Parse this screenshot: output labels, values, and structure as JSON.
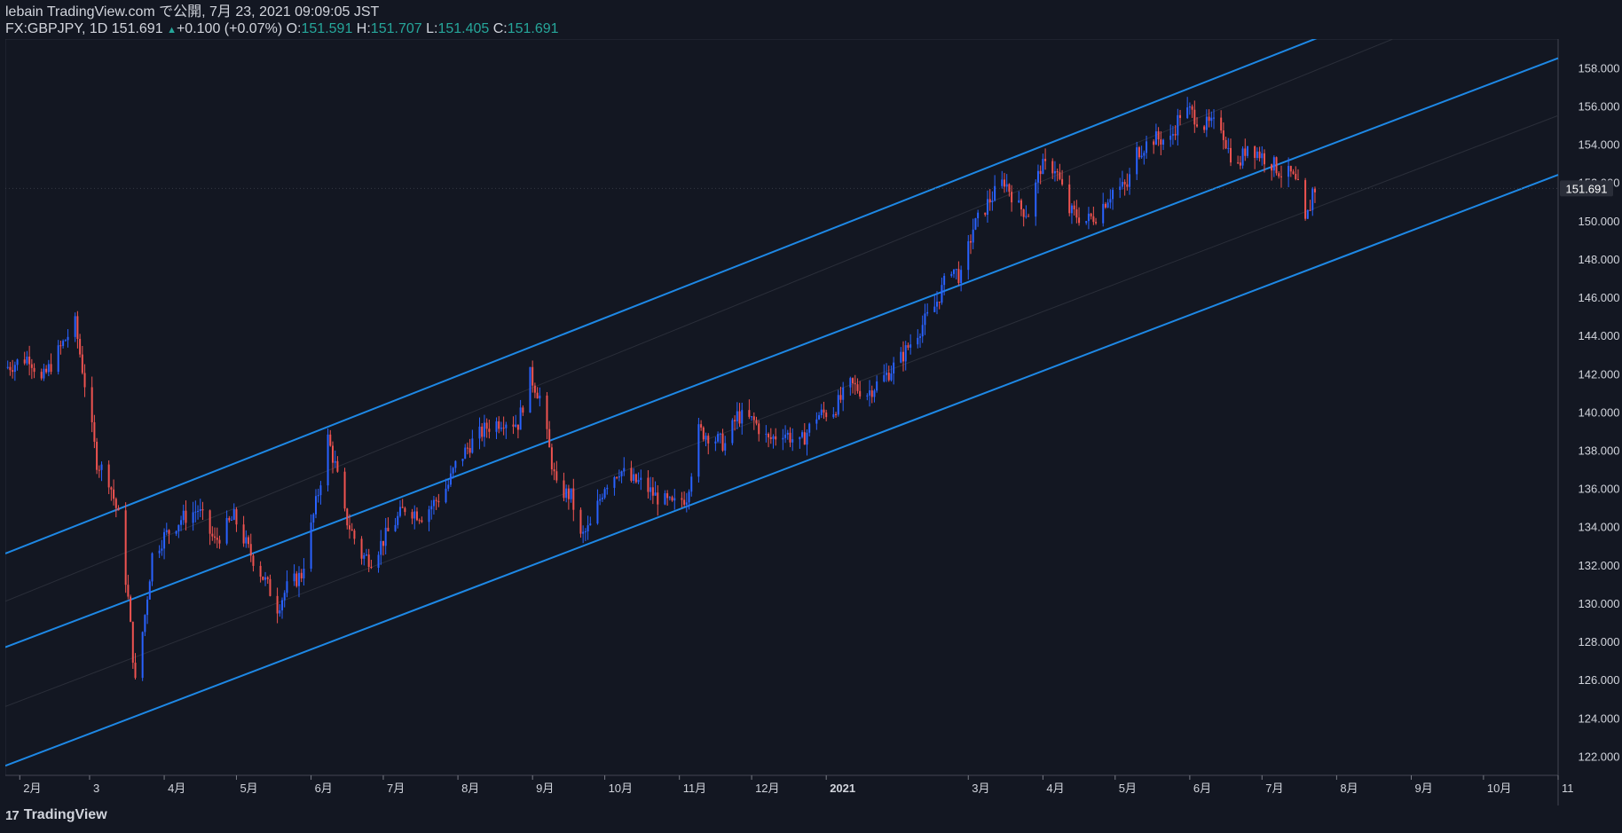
{
  "header": {
    "line1": "lebain TradingView.com で公開, 7月 23, 2021 09:09:05 JST",
    "symbol": "FX:GBPJPY, 1D",
    "last": "151.691",
    "change": "+0.100 (+0.07%)",
    "o_label": "O:",
    "o_value": "151.591",
    "h_label": "H:",
    "h_value": "151.707",
    "l_label": "L:",
    "l_value": "151.405",
    "c_label": "C:",
    "c_value": "151.691"
  },
  "footer": {
    "brand": "TradingView",
    "logo": "17"
  },
  "colors": {
    "background": "#131722",
    "up": "#2962ff",
    "down": "#ef5350",
    "channel": "#1e88e5",
    "text": "#d1d4dc",
    "accent": "#26a69a"
  },
  "chart_data": {
    "type": "candlestick",
    "symbol": "FX:GBPJPY",
    "interval": "1D",
    "ylim": [
      121,
      159.5
    ],
    "x_range": [
      "2020-01-26",
      "2021-11-01"
    ],
    "y_ticks": [
      "122.000",
      "124.000",
      "126.000",
      "128.000",
      "130.000",
      "132.000",
      "134.000",
      "136.000",
      "138.000",
      "140.000",
      "142.000",
      "144.000",
      "146.000",
      "148.000",
      "150.000",
      "152.000",
      "154.000",
      "156.000",
      "158.000"
    ],
    "x_ticks": [
      {
        "label": "2月",
        "date": "2020-02-01"
      },
      {
        "label": "3",
        "date": "2020-03-01"
      },
      {
        "label": "4月",
        "date": "2020-04-01"
      },
      {
        "label": "5月",
        "date": "2020-05-01"
      },
      {
        "label": "6月",
        "date": "2020-06-01"
      },
      {
        "label": "7月",
        "date": "2020-07-01"
      },
      {
        "label": "8月",
        "date": "2020-08-01"
      },
      {
        "label": "9月",
        "date": "2020-09-01"
      },
      {
        "label": "10月",
        "date": "2020-10-01"
      },
      {
        "label": "11月",
        "date": "2020-11-01"
      },
      {
        "label": "12月",
        "date": "2020-12-01"
      },
      {
        "label": "2021",
        "date": "2021-01-01"
      },
      {
        "label": "3月",
        "date": "2021-03-01"
      },
      {
        "label": "4月",
        "date": "2021-04-01"
      },
      {
        "label": "5月",
        "date": "2021-05-01"
      },
      {
        "label": "6月",
        "date": "2021-06-01"
      },
      {
        "label": "7月",
        "date": "2021-07-01"
      },
      {
        "label": "8月",
        "date": "2021-08-01"
      },
      {
        "label": "9月",
        "date": "2021-09-01"
      },
      {
        "label": "10月",
        "date": "2021-10-01"
      },
      {
        "label": "11",
        "date": "2021-11-01"
      }
    ],
    "last_price": "151.691",
    "last_price_value": 151.691,
    "price_path": [
      [
        "2020-01-26",
        142.3
      ],
      [
        "2020-02-05",
        142.9
      ],
      [
        "2020-02-10",
        141.6
      ],
      [
        "2020-02-20",
        143.8
      ],
      [
        "2020-02-24",
        144.6
      ],
      [
        "2020-02-28",
        141.5
      ],
      [
        "2020-03-04",
        137.4
      ],
      [
        "2020-03-09",
        136.5
      ],
      [
        "2020-03-13",
        134.5
      ],
      [
        "2020-03-17",
        130.2
      ],
      [
        "2020-03-20",
        125.8
      ],
      [
        "2020-03-24",
        129.4
      ],
      [
        "2020-03-27",
        132.5
      ],
      [
        "2020-04-01",
        133.5
      ],
      [
        "2020-04-08",
        134.4
      ],
      [
        "2020-04-15",
        134.9
      ],
      [
        "2020-04-22",
        133.2
      ],
      [
        "2020-04-30",
        134.5
      ],
      [
        "2020-05-06",
        132.8
      ],
      [
        "2020-05-14",
        130.9
      ],
      [
        "2020-05-18",
        129.8
      ],
      [
        "2020-05-22",
        130.8
      ],
      [
        "2020-05-28",
        131.5
      ],
      [
        "2020-06-04",
        135.8
      ],
      [
        "2020-06-08",
        138.6
      ],
      [
        "2020-06-11",
        137.2
      ],
      [
        "2020-06-15",
        134.6
      ],
      [
        "2020-06-22",
        132.5
      ],
      [
        "2020-06-26",
        132.3
      ],
      [
        "2020-07-03",
        133.7
      ],
      [
        "2020-07-10",
        135.0
      ],
      [
        "2020-07-17",
        134.6
      ],
      [
        "2020-07-24",
        135.5
      ],
      [
        "2020-07-28",
        136.2
      ],
      [
        "2020-07-31",
        137.2
      ],
      [
        "2020-08-06",
        138.3
      ],
      [
        "2020-08-13",
        139.2
      ],
      [
        "2020-08-20",
        139.6
      ],
      [
        "2020-08-26",
        139.4
      ],
      [
        "2020-08-31",
        141.9
      ],
      [
        "2020-09-04",
        140.8
      ],
      [
        "2020-09-08",
        138.0
      ],
      [
        "2020-09-11",
        136.0
      ],
      [
        "2020-09-17",
        135.6
      ],
      [
        "2020-09-21",
        133.4
      ],
      [
        "2020-09-25",
        134.0
      ],
      [
        "2020-10-01",
        136.2
      ],
      [
        "2020-10-07",
        137.0
      ],
      [
        "2020-10-12",
        136.4
      ],
      [
        "2020-10-16",
        136.3
      ],
      [
        "2020-10-22",
        135.6
      ],
      [
        "2020-10-29",
        135.1
      ],
      [
        "2020-11-04",
        135.6
      ],
      [
        "2020-11-09",
        139.0
      ],
      [
        "2020-11-13",
        138.8
      ],
      [
        "2020-11-20",
        138.3
      ],
      [
        "2020-11-25",
        139.8
      ],
      [
        "2020-12-02",
        139.5
      ],
      [
        "2020-12-08",
        138.5
      ],
      [
        "2020-12-14",
        139.0
      ],
      [
        "2020-12-21",
        138.3
      ],
      [
        "2020-12-28",
        139.8
      ],
      [
        "2021-01-04",
        140.1
      ],
      [
        "2021-01-11",
        141.4
      ],
      [
        "2021-01-18",
        141.0
      ],
      [
        "2021-01-25",
        141.8
      ],
      [
        "2021-02-01",
        142.8
      ],
      [
        "2021-02-08",
        144.2
      ],
      [
        "2021-02-15",
        145.5
      ],
      [
        "2021-02-22",
        147.6
      ],
      [
        "2021-02-26",
        147.0
      ],
      [
        "2021-03-03",
        149.6
      ],
      [
        "2021-03-10",
        151.1
      ],
      [
        "2021-03-16",
        152.1
      ],
      [
        "2021-03-22",
        150.7
      ],
      [
        "2021-03-26",
        150.4
      ],
      [
        "2021-03-31",
        152.8
      ],
      [
        "2021-04-06",
        152.8
      ],
      [
        "2021-04-12",
        150.5
      ],
      [
        "2021-04-19",
        150.0
      ],
      [
        "2021-04-23",
        150.3
      ],
      [
        "2021-04-30",
        151.6
      ],
      [
        "2021-05-06",
        151.8
      ],
      [
        "2021-05-10",
        153.6
      ],
      [
        "2021-05-17",
        154.3
      ],
      [
        "2021-05-24",
        154.2
      ],
      [
        "2021-05-28",
        155.6
      ],
      [
        "2021-06-01",
        155.7
      ],
      [
        "2021-06-07",
        155.0
      ],
      [
        "2021-06-14",
        155.0
      ],
      [
        "2021-06-17",
        153.7
      ],
      [
        "2021-06-21",
        152.8
      ],
      [
        "2021-06-25",
        154.0
      ],
      [
        "2021-06-30",
        153.5
      ],
      [
        "2021-07-06",
        152.9
      ],
      [
        "2021-07-09",
        152.5
      ],
      [
        "2021-07-13",
        152.4
      ],
      [
        "2021-07-16",
        151.7
      ],
      [
        "2021-07-19",
        149.8
      ],
      [
        "2021-07-21",
        150.8
      ],
      [
        "2021-07-22",
        151.6
      ],
      [
        "2021-07-23",
        151.691
      ]
    ],
    "channel_lines": [
      {
        "start": [
          "2020-01-26",
          132.6
        ],
        "end": [
          "2021-07-29",
          159.8
        ]
      },
      {
        "start": [
          "2020-01-26",
          127.7
        ],
        "end": [
          "2021-11-01",
          158.5
        ]
      },
      {
        "start": [
          "2020-01-26",
          121.5
        ],
        "end": [
          "2021-11-01",
          152.4
        ]
      }
    ],
    "channel_mid_lines": [
      {
        "start": [
          "2020-01-26",
          130.1
        ],
        "end": [
          "2021-11-01",
          163.0
        ]
      },
      {
        "start": [
          "2020-01-26",
          124.6
        ],
        "end": [
          "2021-11-01",
          155.5
        ]
      }
    ]
  }
}
